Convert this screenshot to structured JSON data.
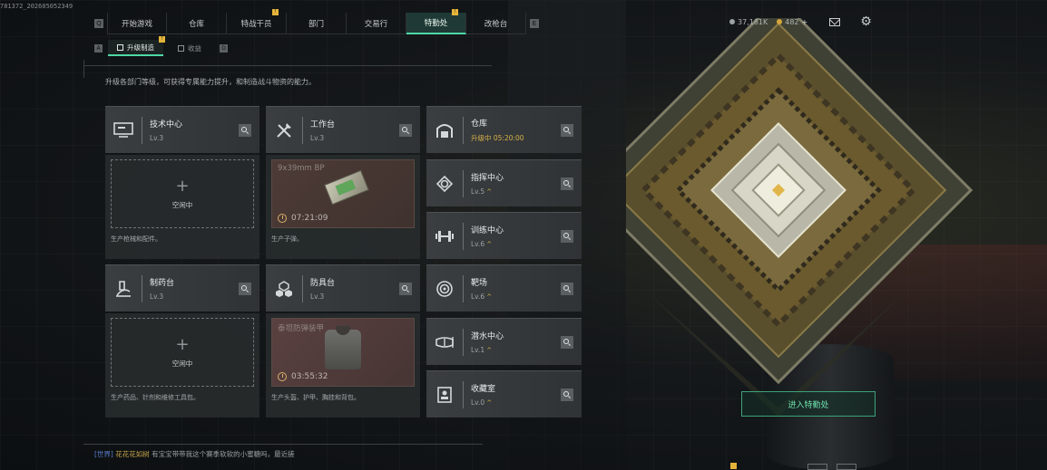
{
  "session_id": "781372_202605052349",
  "nav": {
    "tabs": [
      {
        "label": "开始游戏",
        "active": false,
        "badge": false
      },
      {
        "label": "仓库",
        "active": false,
        "badge": false
      },
      {
        "label": "特战干员",
        "active": false,
        "badge": true
      },
      {
        "label": "部门",
        "active": false,
        "badge": false
      },
      {
        "label": "交易行",
        "active": false,
        "badge": false
      },
      {
        "label": "特勤处",
        "active": true,
        "badge": true
      },
      {
        "label": "改枪台",
        "active": false,
        "badge": false
      }
    ],
    "prev_key": "Q",
    "next_key": "E"
  },
  "currency": {
    "coins": "37,181K",
    "tokens": "482",
    "plus": "+"
  },
  "subnav": {
    "tabs": [
      {
        "label": "升级制造",
        "active": true,
        "badge": true
      },
      {
        "label": "收益",
        "active": false,
        "badge": false
      }
    ],
    "prev_key": "A",
    "next_key": "D"
  },
  "description": "升级各部门等级，可获得专属能力提升，和制造战斗物资的能力。",
  "facilities": {
    "tech_center": {
      "name": "技术中心",
      "level": "Lv.3",
      "slot_text": "空闲中",
      "footer": "生产枪械和配件。"
    },
    "workbench": {
      "name": "工作台",
      "level": "Lv.3",
      "product": "9x39mm BP",
      "timer": "07:21:09",
      "footer": "生产子弹。"
    },
    "pharmacy": {
      "name": "制药台",
      "level": "Lv.3",
      "slot_text": "空闲中",
      "footer": "生产药品、针剂和维修工具包。"
    },
    "armor_bench": {
      "name": "防具台",
      "level": "Lv.3",
      "product": "泰坦防弹装甲",
      "timer": "03:55:32",
      "footer": "生产头盔、护甲、胸挂和背包。"
    },
    "storage": {
      "name": "仓库",
      "status": "升级中 05:20:00"
    },
    "command": {
      "name": "指挥中心",
      "level": "Lv.5"
    },
    "training": {
      "name": "训练中心",
      "level": "Lv.6"
    },
    "range": {
      "name": "靶场",
      "level": "Lv.6"
    },
    "diving": {
      "name": "潜水中心",
      "level": "Lv.1"
    },
    "collection": {
      "name": "收藏室",
      "level": "Lv.0"
    }
  },
  "level_up_mark": "^",
  "enter_button": "进入特勤处",
  "chat": {
    "channel": "[世界]",
    "sender": "花花花如树",
    "message": "有宝宝带带我这个赛季软软的小蜜糖吗，最近搓"
  },
  "colors": {
    "accent_green": "#4ed8a6",
    "badge_yellow": "#e4b33a",
    "timer_gold": "#d8b048"
  }
}
